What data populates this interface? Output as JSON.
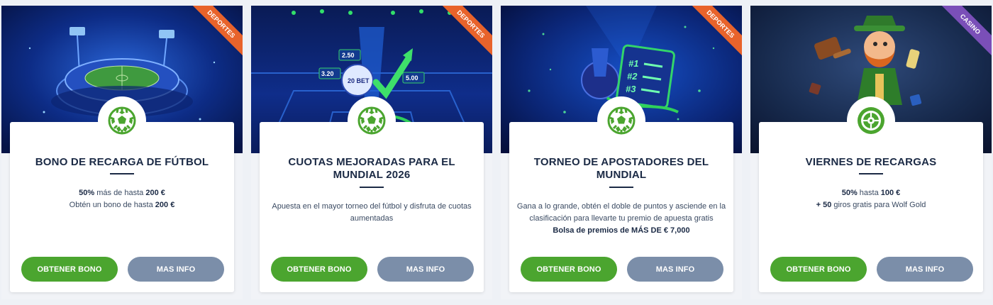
{
  "colors": {
    "deportes_ribbon": "#e8632b",
    "casino_ribbon": "#7a4fb8",
    "primary_button": "#4ba52f",
    "secondary_button": "#7b8ea9",
    "title": "#1b2a45"
  },
  "promotions": [
    {
      "category": "DEPORTES",
      "icon": "soccer-ball-icon",
      "title": "BONO DE RECARGA DE FÚTBOL",
      "line1_bold_a": "50%",
      "line1_text": " más de hasta ",
      "line1_bold_b": "200 €",
      "line2_text": "Obtén un bono de hasta ",
      "line2_bold": "200 €",
      "primary_label": "OBTENER BONO",
      "secondary_label": "MAS INFO"
    },
    {
      "category": "DEPORTES",
      "icon": "soccer-ball-icon",
      "title": "CUOTAS MEJORADAS PARA EL MUNDIAL 2026",
      "description": "Apuesta en el mayor torneo del fútbol y disfruta de cuotas aumentadas",
      "banner_odds": [
        "3.20",
        "2.50",
        "5.00"
      ],
      "banner_logo": "20 BET",
      "primary_label": "OBTENER BONO",
      "secondary_label": "MAS INFO"
    },
    {
      "category": "DEPORTES",
      "icon": "soccer-ball-icon",
      "title": "TORNEO DE APOSTADORES DEL MUNDIAL",
      "description": "Gana a lo grande, obtén el doble de puntos y asciende en la clasificación para llevarte tu premio de apuesta gratis",
      "prize": "Bolsa de premios de MÁS DE € 7,000",
      "banner_ranks": [
        "#1",
        "#2",
        "#3"
      ],
      "primary_label": "OBTENER BONO",
      "secondary_label": "MAS INFO"
    },
    {
      "category": "CASINO",
      "icon": "roulette-icon",
      "title": "VIERNES DE RECARGAS",
      "line1_bold": "50%",
      "line1_text": " hasta ",
      "line1_bold_b": "100 €",
      "line2_bold": "+ 50",
      "line2_text": " giros gratis para Wolf Gold",
      "primary_label": "OBTENER BONO",
      "secondary_label": "MAS INFO"
    }
  ]
}
